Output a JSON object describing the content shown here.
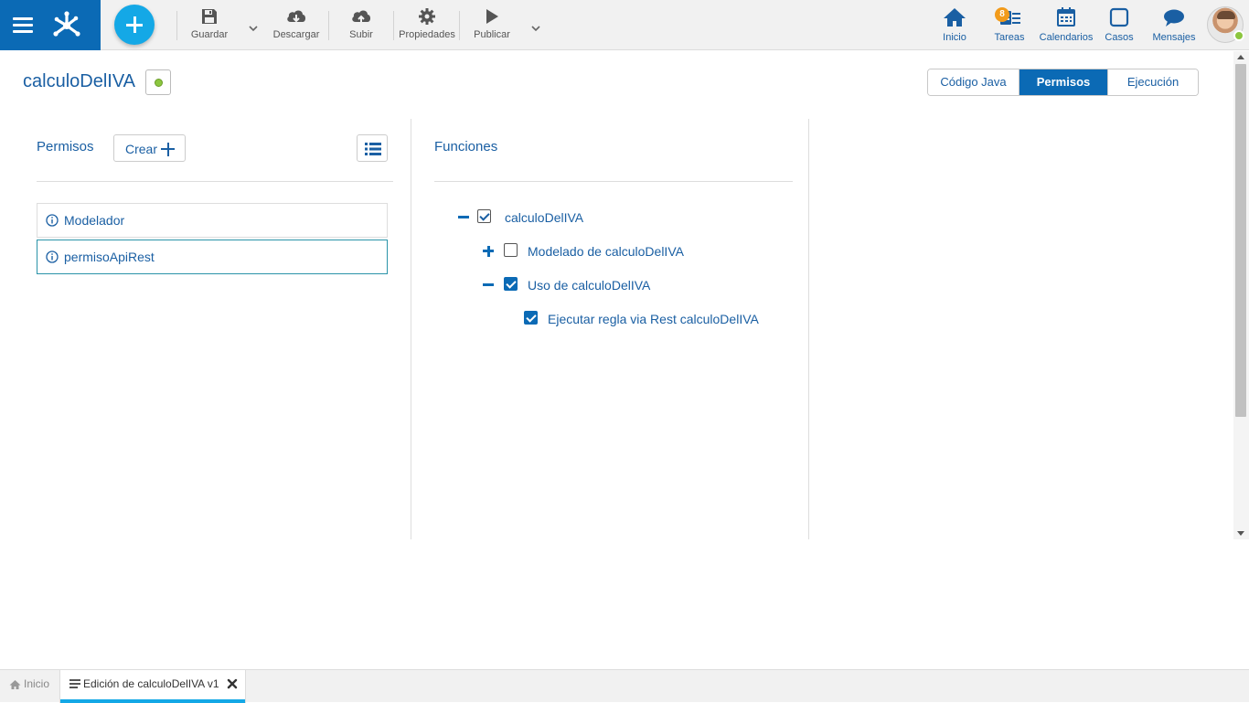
{
  "colors": {
    "brand": "#0b6ab5",
    "accent": "#14a8e6",
    "link": "#1a5fa3",
    "status_ok": "#8cc63f",
    "badge": "#f29b1b"
  },
  "toolbar": {
    "guardar": "Guardar",
    "descargar": "Descargar",
    "subir": "Subir",
    "propiedades": "Propiedades",
    "publicar": "Publicar"
  },
  "nav": {
    "inicio": "Inicio",
    "tareas": "Tareas",
    "tareas_badge": "8",
    "calendarios": "Calendarios",
    "casos": "Casos",
    "mensajes": "Mensajes"
  },
  "page": {
    "title": "calculoDelIVA"
  },
  "view_tabs": [
    {
      "label": "Código Java",
      "active": false
    },
    {
      "label": "Permisos",
      "active": true
    },
    {
      "label": "Ejecución",
      "active": false
    }
  ],
  "permisos": {
    "heading": "Permisos",
    "create_label": "Crear",
    "items": [
      {
        "label": "Modelador",
        "selected": false
      },
      {
        "label": "permisoApiRest",
        "selected": true
      }
    ]
  },
  "funciones": {
    "heading": "Funciones",
    "tree": [
      {
        "label": "calculoDelIVA",
        "checked": true,
        "expanded": true
      },
      {
        "label": "Modelado de calculoDelIVA",
        "checked": false,
        "expanded": false
      },
      {
        "label": "Uso de calculoDelIVA",
        "checked": true,
        "expanded": true
      },
      {
        "label": "Ejecutar regla via Rest calculoDelIVA",
        "checked": true
      }
    ]
  },
  "bottom_tabs": [
    {
      "label": "Inicio",
      "icon": "home-icon",
      "active": false
    },
    {
      "label": "Edición de calculoDelIVA v1",
      "icon": "editor-icon",
      "active": true
    }
  ]
}
